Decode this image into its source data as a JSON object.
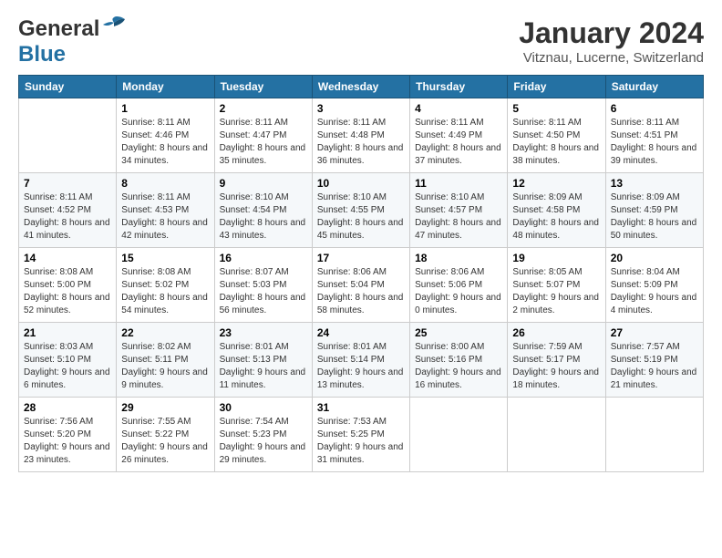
{
  "header": {
    "logo_general": "General",
    "logo_blue": "Blue",
    "month_title": "January 2024",
    "location": "Vitznau, Lucerne, Switzerland"
  },
  "weekdays": [
    "Sunday",
    "Monday",
    "Tuesday",
    "Wednesday",
    "Thursday",
    "Friday",
    "Saturday"
  ],
  "weeks": [
    [
      {
        "day": "",
        "sunrise": "",
        "sunset": "",
        "daylight": ""
      },
      {
        "day": "1",
        "sunrise": "Sunrise: 8:11 AM",
        "sunset": "Sunset: 4:46 PM",
        "daylight": "Daylight: 8 hours and 34 minutes."
      },
      {
        "day": "2",
        "sunrise": "Sunrise: 8:11 AM",
        "sunset": "Sunset: 4:47 PM",
        "daylight": "Daylight: 8 hours and 35 minutes."
      },
      {
        "day": "3",
        "sunrise": "Sunrise: 8:11 AM",
        "sunset": "Sunset: 4:48 PM",
        "daylight": "Daylight: 8 hours and 36 minutes."
      },
      {
        "day": "4",
        "sunrise": "Sunrise: 8:11 AM",
        "sunset": "Sunset: 4:49 PM",
        "daylight": "Daylight: 8 hours and 37 minutes."
      },
      {
        "day": "5",
        "sunrise": "Sunrise: 8:11 AM",
        "sunset": "Sunset: 4:50 PM",
        "daylight": "Daylight: 8 hours and 38 minutes."
      },
      {
        "day": "6",
        "sunrise": "Sunrise: 8:11 AM",
        "sunset": "Sunset: 4:51 PM",
        "daylight": "Daylight: 8 hours and 39 minutes."
      }
    ],
    [
      {
        "day": "7",
        "sunrise": "Sunrise: 8:11 AM",
        "sunset": "Sunset: 4:52 PM",
        "daylight": "Daylight: 8 hours and 41 minutes."
      },
      {
        "day": "8",
        "sunrise": "Sunrise: 8:11 AM",
        "sunset": "Sunset: 4:53 PM",
        "daylight": "Daylight: 8 hours and 42 minutes."
      },
      {
        "day": "9",
        "sunrise": "Sunrise: 8:10 AM",
        "sunset": "Sunset: 4:54 PM",
        "daylight": "Daylight: 8 hours and 43 minutes."
      },
      {
        "day": "10",
        "sunrise": "Sunrise: 8:10 AM",
        "sunset": "Sunset: 4:55 PM",
        "daylight": "Daylight: 8 hours and 45 minutes."
      },
      {
        "day": "11",
        "sunrise": "Sunrise: 8:10 AM",
        "sunset": "Sunset: 4:57 PM",
        "daylight": "Daylight: 8 hours and 47 minutes."
      },
      {
        "day": "12",
        "sunrise": "Sunrise: 8:09 AM",
        "sunset": "Sunset: 4:58 PM",
        "daylight": "Daylight: 8 hours and 48 minutes."
      },
      {
        "day": "13",
        "sunrise": "Sunrise: 8:09 AM",
        "sunset": "Sunset: 4:59 PM",
        "daylight": "Daylight: 8 hours and 50 minutes."
      }
    ],
    [
      {
        "day": "14",
        "sunrise": "Sunrise: 8:08 AM",
        "sunset": "Sunset: 5:00 PM",
        "daylight": "Daylight: 8 hours and 52 minutes."
      },
      {
        "day": "15",
        "sunrise": "Sunrise: 8:08 AM",
        "sunset": "Sunset: 5:02 PM",
        "daylight": "Daylight: 8 hours and 54 minutes."
      },
      {
        "day": "16",
        "sunrise": "Sunrise: 8:07 AM",
        "sunset": "Sunset: 5:03 PM",
        "daylight": "Daylight: 8 hours and 56 minutes."
      },
      {
        "day": "17",
        "sunrise": "Sunrise: 8:06 AM",
        "sunset": "Sunset: 5:04 PM",
        "daylight": "Daylight: 8 hours and 58 minutes."
      },
      {
        "day": "18",
        "sunrise": "Sunrise: 8:06 AM",
        "sunset": "Sunset: 5:06 PM",
        "daylight": "Daylight: 9 hours and 0 minutes."
      },
      {
        "day": "19",
        "sunrise": "Sunrise: 8:05 AM",
        "sunset": "Sunset: 5:07 PM",
        "daylight": "Daylight: 9 hours and 2 minutes."
      },
      {
        "day": "20",
        "sunrise": "Sunrise: 8:04 AM",
        "sunset": "Sunset: 5:09 PM",
        "daylight": "Daylight: 9 hours and 4 minutes."
      }
    ],
    [
      {
        "day": "21",
        "sunrise": "Sunrise: 8:03 AM",
        "sunset": "Sunset: 5:10 PM",
        "daylight": "Daylight: 9 hours and 6 minutes."
      },
      {
        "day": "22",
        "sunrise": "Sunrise: 8:02 AM",
        "sunset": "Sunset: 5:11 PM",
        "daylight": "Daylight: 9 hours and 9 minutes."
      },
      {
        "day": "23",
        "sunrise": "Sunrise: 8:01 AM",
        "sunset": "Sunset: 5:13 PM",
        "daylight": "Daylight: 9 hours and 11 minutes."
      },
      {
        "day": "24",
        "sunrise": "Sunrise: 8:01 AM",
        "sunset": "Sunset: 5:14 PM",
        "daylight": "Daylight: 9 hours and 13 minutes."
      },
      {
        "day": "25",
        "sunrise": "Sunrise: 8:00 AM",
        "sunset": "Sunset: 5:16 PM",
        "daylight": "Daylight: 9 hours and 16 minutes."
      },
      {
        "day": "26",
        "sunrise": "Sunrise: 7:59 AM",
        "sunset": "Sunset: 5:17 PM",
        "daylight": "Daylight: 9 hours and 18 minutes."
      },
      {
        "day": "27",
        "sunrise": "Sunrise: 7:57 AM",
        "sunset": "Sunset: 5:19 PM",
        "daylight": "Daylight: 9 hours and 21 minutes."
      }
    ],
    [
      {
        "day": "28",
        "sunrise": "Sunrise: 7:56 AM",
        "sunset": "Sunset: 5:20 PM",
        "daylight": "Daylight: 9 hours and 23 minutes."
      },
      {
        "day": "29",
        "sunrise": "Sunrise: 7:55 AM",
        "sunset": "Sunset: 5:22 PM",
        "daylight": "Daylight: 9 hours and 26 minutes."
      },
      {
        "day": "30",
        "sunrise": "Sunrise: 7:54 AM",
        "sunset": "Sunset: 5:23 PM",
        "daylight": "Daylight: 9 hours and 29 minutes."
      },
      {
        "day": "31",
        "sunrise": "Sunrise: 7:53 AM",
        "sunset": "Sunset: 5:25 PM",
        "daylight": "Daylight: 9 hours and 31 minutes."
      },
      {
        "day": "",
        "sunrise": "",
        "sunset": "",
        "daylight": ""
      },
      {
        "day": "",
        "sunrise": "",
        "sunset": "",
        "daylight": ""
      },
      {
        "day": "",
        "sunrise": "",
        "sunset": "",
        "daylight": ""
      }
    ]
  ]
}
